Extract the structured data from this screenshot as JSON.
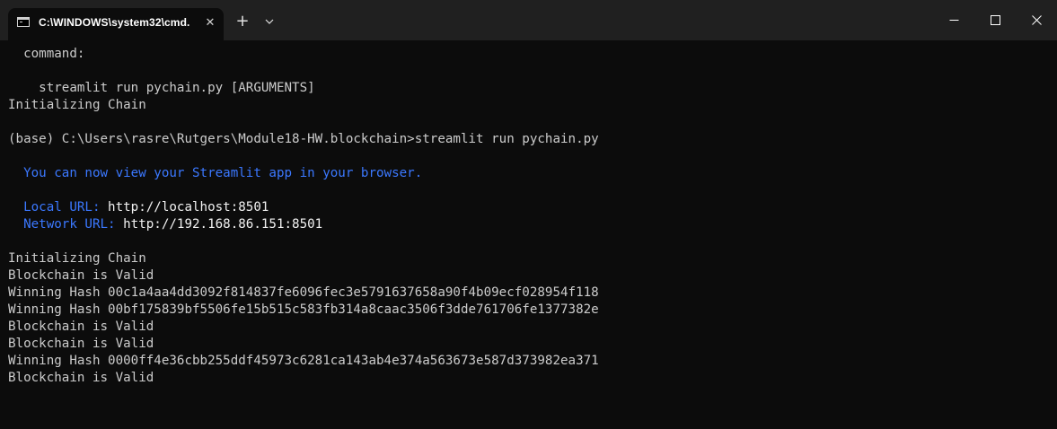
{
  "window": {
    "tab_title": "C:\\WINDOWS\\system32\\cmd.",
    "tab_close_glyph": "✕",
    "new_tab_glyph": "+",
    "icons": {
      "tab": "cmd-icon",
      "close_tab": "close-icon",
      "new_tab": "plus-icon",
      "dropdown": "chevron-down-icon",
      "minimize": "minimize-icon",
      "maximize": "maximize-icon",
      "close": "close-window-icon"
    }
  },
  "colors": {
    "background": "#0c0c0c",
    "titlebar": "#202020",
    "text": "#cccccc",
    "bright_text": "#f2f2f2",
    "blue": "#3b78ff"
  },
  "terminal": {
    "lines": [
      {
        "text": "  command:"
      },
      {
        "text": ""
      },
      {
        "text": "    streamlit run pychain.py [ARGUMENTS]"
      },
      {
        "text": "Initializing Chain"
      },
      {
        "text": ""
      },
      {
        "text": "(base) C:\\Users\\rasre\\Rutgers\\Module18-HW.blockchain>streamlit run pychain.py"
      },
      {
        "text": ""
      },
      {
        "text": "  You can now view your Streamlit app in your browser."
      },
      {
        "text": ""
      },
      {
        "label": "  Local URL: ",
        "value": "http://localhost:8501"
      },
      {
        "label": "  Network URL: ",
        "value": "http://192.168.86.151:8501"
      },
      {
        "text": ""
      },
      {
        "text": "Initializing Chain"
      },
      {
        "text": "Blockchain is Valid"
      },
      {
        "text": "Winning Hash 00c1a4aa4dd3092f814837fe6096fec3e5791637658a90f4b09ecf028954f118"
      },
      {
        "text": "Winning Hash 00bf175839bf5506fe15b515c583fb314a8caac3506f3dde761706fe1377382e"
      },
      {
        "text": "Blockchain is Valid"
      },
      {
        "text": "Blockchain is Valid"
      },
      {
        "text": "Winning Hash 0000ff4e36cbb255ddf45973c6281ca143ab4e374a563673e587d373982ea371"
      },
      {
        "text": "Blockchain is Valid"
      }
    ]
  }
}
